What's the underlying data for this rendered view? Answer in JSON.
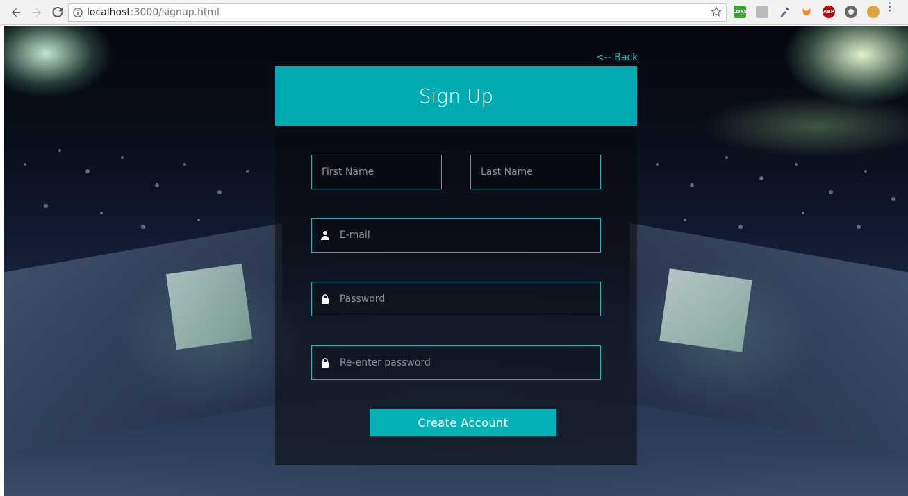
{
  "browser": {
    "url_host": "localhost",
    "url_path": ":3000/signup.html",
    "extensions": [
      {
        "name": "cors-extension-icon",
        "label": "CORS",
        "color": "#3aa531"
      },
      {
        "name": "screen-capture-icon",
        "label": "",
        "color": "#9a9a9a"
      },
      {
        "name": "eyedropper-icon",
        "label": "",
        "color": "#6b4fbb"
      },
      {
        "name": "metamask-fox-icon",
        "label": "",
        "color": "#f6851b"
      },
      {
        "name": "adblock-plus-icon",
        "label": "ABP",
        "color": "#c00000"
      },
      {
        "name": "circle-extension-icon",
        "label": "",
        "color": "#6a6a6a"
      },
      {
        "name": "cookie-icon",
        "label": "",
        "color": "#d9a441"
      }
    ]
  },
  "page": {
    "back_link": "<-- Back",
    "title": "Sign Up",
    "fields": {
      "first_name_placeholder": "First Name",
      "last_name_placeholder": "Last Name",
      "email_placeholder": "E-mail",
      "password_placeholder": "Password",
      "reenter_password_placeholder": "Re-enter password"
    },
    "submit_label": "Create Account"
  },
  "colors": {
    "accent": "#05b3b7",
    "header": "#00bec3",
    "border": "#1fb8bb",
    "link": "#1fc2c4"
  }
}
